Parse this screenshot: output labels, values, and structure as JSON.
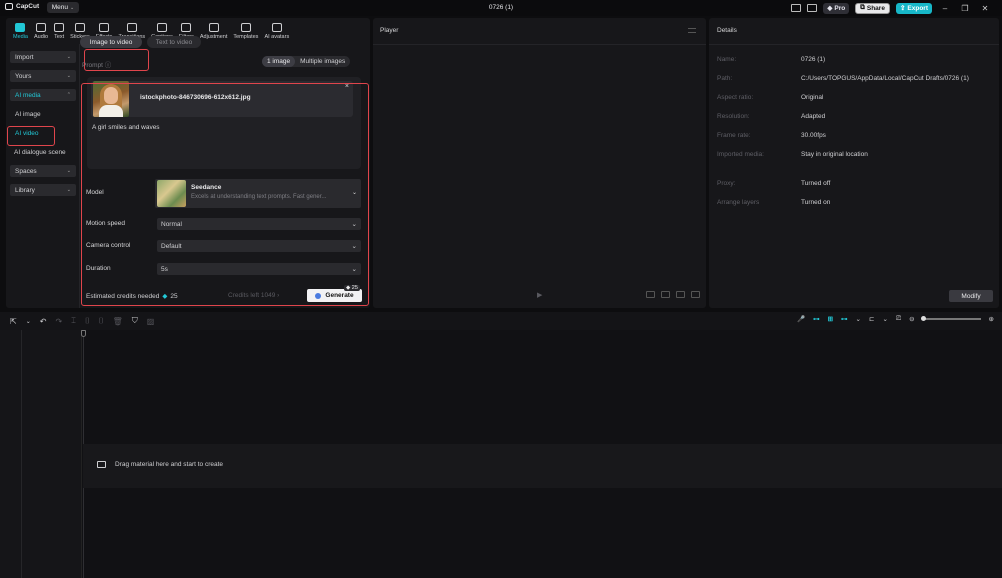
{
  "titlebar": {
    "app_name": "CapCut",
    "menu_label": "Menu",
    "window_title": "0726 (1)",
    "pro_label": "Pro",
    "share_label": "Share",
    "export_label": "Export"
  },
  "media_tabs": [
    {
      "label": "Media",
      "icon": "media-icon",
      "active": true
    },
    {
      "label": "Audio",
      "icon": "audio-icon"
    },
    {
      "label": "Text",
      "icon": "text-icon"
    },
    {
      "label": "Stickers",
      "icon": "stickers-icon"
    },
    {
      "label": "Effects",
      "icon": "effects-icon"
    },
    {
      "label": "Transitions",
      "icon": "transitions-icon"
    },
    {
      "label": "Captions",
      "icon": "captions-icon"
    },
    {
      "label": "Filters",
      "icon": "filters-icon"
    },
    {
      "label": "Adjustment",
      "icon": "adjustment-icon"
    },
    {
      "label": "Templates",
      "icon": "templates-icon"
    },
    {
      "label": "AI avatars",
      "icon": "ai-avatars-icon"
    }
  ],
  "sidenav": {
    "import": "Import",
    "yours": "Yours",
    "ai_media": "AI media",
    "ai_image": "AI image",
    "ai_video": "AI video",
    "ai_dialogue": "AI dialogue scene",
    "spaces": "Spaces",
    "library": "Library"
  },
  "generator": {
    "image_to_video": "Image to video",
    "text_to_video": "Text to video",
    "prompt_label": "Prompt",
    "one_image": "1 image",
    "multiple_images": "Multiple images",
    "file_name": "istockphoto-846730696-612x612.jpg",
    "prompt_text": "A girl smiles and waves",
    "model_label": "Model",
    "model_name": "Seedance",
    "model_desc": "Excels at understanding text prompts. Fast gener...",
    "motion_label": "Motion speed",
    "motion_value": "Normal",
    "camera_label": "Camera control",
    "camera_value": "Default",
    "duration_label": "Duration",
    "duration_value": "5s",
    "credits_label": "Estimated credits needed",
    "credits_value": "25",
    "credits_left": "Credits left 1049",
    "generate_label": "Generate",
    "generate_badge": "25"
  },
  "player": {
    "title": "Player"
  },
  "details": {
    "title": "Details",
    "rows": [
      {
        "key": "Name:",
        "value": "0726 (1)"
      },
      {
        "key": "Path:",
        "value": "C:/Users/TOPGUS/AppData/Local/CapCut Drafts/0726 (1)"
      },
      {
        "key": "Aspect ratio:",
        "value": "Original"
      },
      {
        "key": "Resolution:",
        "value": "Adapted"
      },
      {
        "key": "Frame rate:",
        "value": "30.00fps"
      },
      {
        "key": "Imported media:",
        "value": "Stay in original location"
      },
      {
        "key": "Proxy:",
        "value": "Turned off"
      },
      {
        "key": "Arrange layers",
        "value": "Turned on"
      }
    ],
    "modify_label": "Modify"
  },
  "timeline": {
    "drag_hint": "Drag material here and start to create"
  },
  "colors": {
    "accent": "#22c8d6",
    "highlight": "#e0454c",
    "export": "#17b7c8"
  }
}
